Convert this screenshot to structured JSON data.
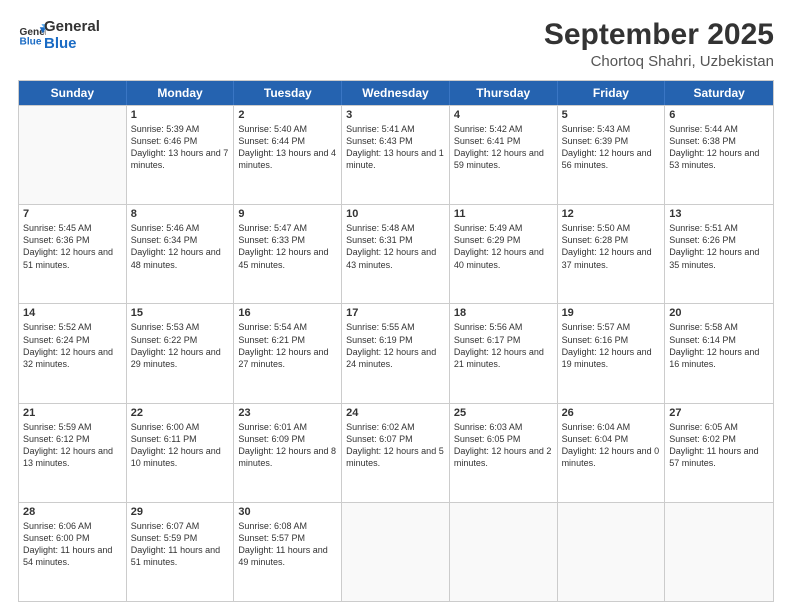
{
  "logo": {
    "line1": "General",
    "line2": "Blue"
  },
  "title": "September 2025",
  "subtitle": "Chortoq Shahri, Uzbekistan",
  "header_days": [
    "Sunday",
    "Monday",
    "Tuesday",
    "Wednesday",
    "Thursday",
    "Friday",
    "Saturday"
  ],
  "weeks": [
    [
      {
        "day": "",
        "empty": true
      },
      {
        "day": "1",
        "sunrise": "5:39 AM",
        "sunset": "6:46 PM",
        "daylight": "13 hours and 7 minutes."
      },
      {
        "day": "2",
        "sunrise": "5:40 AM",
        "sunset": "6:44 PM",
        "daylight": "13 hours and 4 minutes."
      },
      {
        "day": "3",
        "sunrise": "5:41 AM",
        "sunset": "6:43 PM",
        "daylight": "13 hours and 1 minute."
      },
      {
        "day": "4",
        "sunrise": "5:42 AM",
        "sunset": "6:41 PM",
        "daylight": "12 hours and 59 minutes."
      },
      {
        "day": "5",
        "sunrise": "5:43 AM",
        "sunset": "6:39 PM",
        "daylight": "12 hours and 56 minutes."
      },
      {
        "day": "6",
        "sunrise": "5:44 AM",
        "sunset": "6:38 PM",
        "daylight": "12 hours and 53 minutes."
      }
    ],
    [
      {
        "day": "7",
        "sunrise": "5:45 AM",
        "sunset": "6:36 PM",
        "daylight": "12 hours and 51 minutes."
      },
      {
        "day": "8",
        "sunrise": "5:46 AM",
        "sunset": "6:34 PM",
        "daylight": "12 hours and 48 minutes."
      },
      {
        "day": "9",
        "sunrise": "5:47 AM",
        "sunset": "6:33 PM",
        "daylight": "12 hours and 45 minutes."
      },
      {
        "day": "10",
        "sunrise": "5:48 AM",
        "sunset": "6:31 PM",
        "daylight": "12 hours and 43 minutes."
      },
      {
        "day": "11",
        "sunrise": "5:49 AM",
        "sunset": "6:29 PM",
        "daylight": "12 hours and 40 minutes."
      },
      {
        "day": "12",
        "sunrise": "5:50 AM",
        "sunset": "6:28 PM",
        "daylight": "12 hours and 37 minutes."
      },
      {
        "day": "13",
        "sunrise": "5:51 AM",
        "sunset": "6:26 PM",
        "daylight": "12 hours and 35 minutes."
      }
    ],
    [
      {
        "day": "14",
        "sunrise": "5:52 AM",
        "sunset": "6:24 PM",
        "daylight": "12 hours and 32 minutes."
      },
      {
        "day": "15",
        "sunrise": "5:53 AM",
        "sunset": "6:22 PM",
        "daylight": "12 hours and 29 minutes."
      },
      {
        "day": "16",
        "sunrise": "5:54 AM",
        "sunset": "6:21 PM",
        "daylight": "12 hours and 27 minutes."
      },
      {
        "day": "17",
        "sunrise": "5:55 AM",
        "sunset": "6:19 PM",
        "daylight": "12 hours and 24 minutes."
      },
      {
        "day": "18",
        "sunrise": "5:56 AM",
        "sunset": "6:17 PM",
        "daylight": "12 hours and 21 minutes."
      },
      {
        "day": "19",
        "sunrise": "5:57 AM",
        "sunset": "6:16 PM",
        "daylight": "12 hours and 19 minutes."
      },
      {
        "day": "20",
        "sunrise": "5:58 AM",
        "sunset": "6:14 PM",
        "daylight": "12 hours and 16 minutes."
      }
    ],
    [
      {
        "day": "21",
        "sunrise": "5:59 AM",
        "sunset": "6:12 PM",
        "daylight": "12 hours and 13 minutes."
      },
      {
        "day": "22",
        "sunrise": "6:00 AM",
        "sunset": "6:11 PM",
        "daylight": "12 hours and 10 minutes."
      },
      {
        "day": "23",
        "sunrise": "6:01 AM",
        "sunset": "6:09 PM",
        "daylight": "12 hours and 8 minutes."
      },
      {
        "day": "24",
        "sunrise": "6:02 AM",
        "sunset": "6:07 PM",
        "daylight": "12 hours and 5 minutes."
      },
      {
        "day": "25",
        "sunrise": "6:03 AM",
        "sunset": "6:05 PM",
        "daylight": "12 hours and 2 minutes."
      },
      {
        "day": "26",
        "sunrise": "6:04 AM",
        "sunset": "6:04 PM",
        "daylight": "12 hours and 0 minutes."
      },
      {
        "day": "27",
        "sunrise": "6:05 AM",
        "sunset": "6:02 PM",
        "daylight": "11 hours and 57 minutes."
      }
    ],
    [
      {
        "day": "28",
        "sunrise": "6:06 AM",
        "sunset": "6:00 PM",
        "daylight": "11 hours and 54 minutes."
      },
      {
        "day": "29",
        "sunrise": "6:07 AM",
        "sunset": "5:59 PM",
        "daylight": "11 hours and 51 minutes."
      },
      {
        "day": "30",
        "sunrise": "6:08 AM",
        "sunset": "5:57 PM",
        "daylight": "11 hours and 49 minutes."
      },
      {
        "day": "",
        "empty": true
      },
      {
        "day": "",
        "empty": true
      },
      {
        "day": "",
        "empty": true
      },
      {
        "day": "",
        "empty": true
      }
    ]
  ]
}
